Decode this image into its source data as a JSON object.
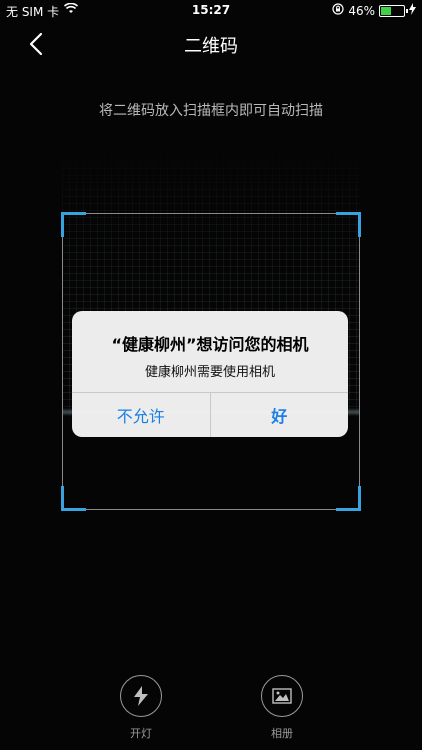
{
  "status_bar": {
    "carrier": "无 SIM 卡",
    "time": "15:27",
    "battery_percent": "46%",
    "battery_level": 0.46
  },
  "nav": {
    "title": "二维码"
  },
  "hint": "将二维码放入扫描框内即可自动扫描",
  "tools": {
    "light_label": "开灯",
    "album_label": "相册"
  },
  "dialog": {
    "title": "“健康柳州”想访问您的相机",
    "message": "健康柳州需要使用相机",
    "deny_label": "不允许",
    "allow_label": "好"
  },
  "colors": {
    "accent": "#3aa3df",
    "button_blue": "#1a7fe6",
    "battery_green": "#3fd14a"
  },
  "icons": {
    "back": "chevron-left-icon",
    "light": "flash-icon",
    "album": "image-icon",
    "wifi": "wifi-icon",
    "lock": "rotation-lock-icon",
    "charging": "bolt-icon"
  }
}
